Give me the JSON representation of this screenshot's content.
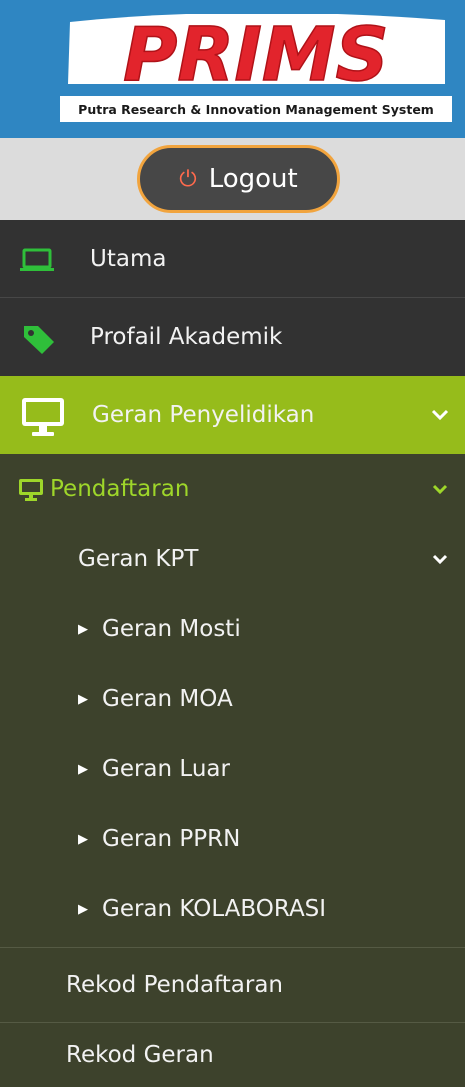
{
  "logo": {
    "title": "PRIMS",
    "subtitle": "Putra Research & Innovation Management System"
  },
  "logout": {
    "label": "Logout"
  },
  "menu": {
    "utama": "Utama",
    "profail": "Profail Akademik",
    "geran": "Geran Penyelidikan",
    "pendaftaran": "Pendaftaran",
    "geran_kpt": "Geran KPT",
    "sub_items": [
      "Geran Mosti",
      "Geran MOA",
      "Geran Luar",
      "Geran PPRN",
      "Geran KOLABORASI"
    ],
    "rekod_pendaftaran": "Rekod Pendaftaran",
    "rekod_geran": "Rekod Geran"
  },
  "colors": {
    "logo_bg": "#2f86c2",
    "logo_red": "#e2242c",
    "active_green": "#96bc1b",
    "sub_green": "#9ed62a",
    "menu_dark": "#323232",
    "submenu_olive": "#3d422c",
    "logout_border": "#f1a43e"
  },
  "icons": {
    "utama": "laptop-icon",
    "profail": "tag-icon",
    "geran": "monitor-icon",
    "pendaftaran": "monitor-icon",
    "chevrons": "chevron-down-icon",
    "sub_items": "caret-right-icon"
  }
}
